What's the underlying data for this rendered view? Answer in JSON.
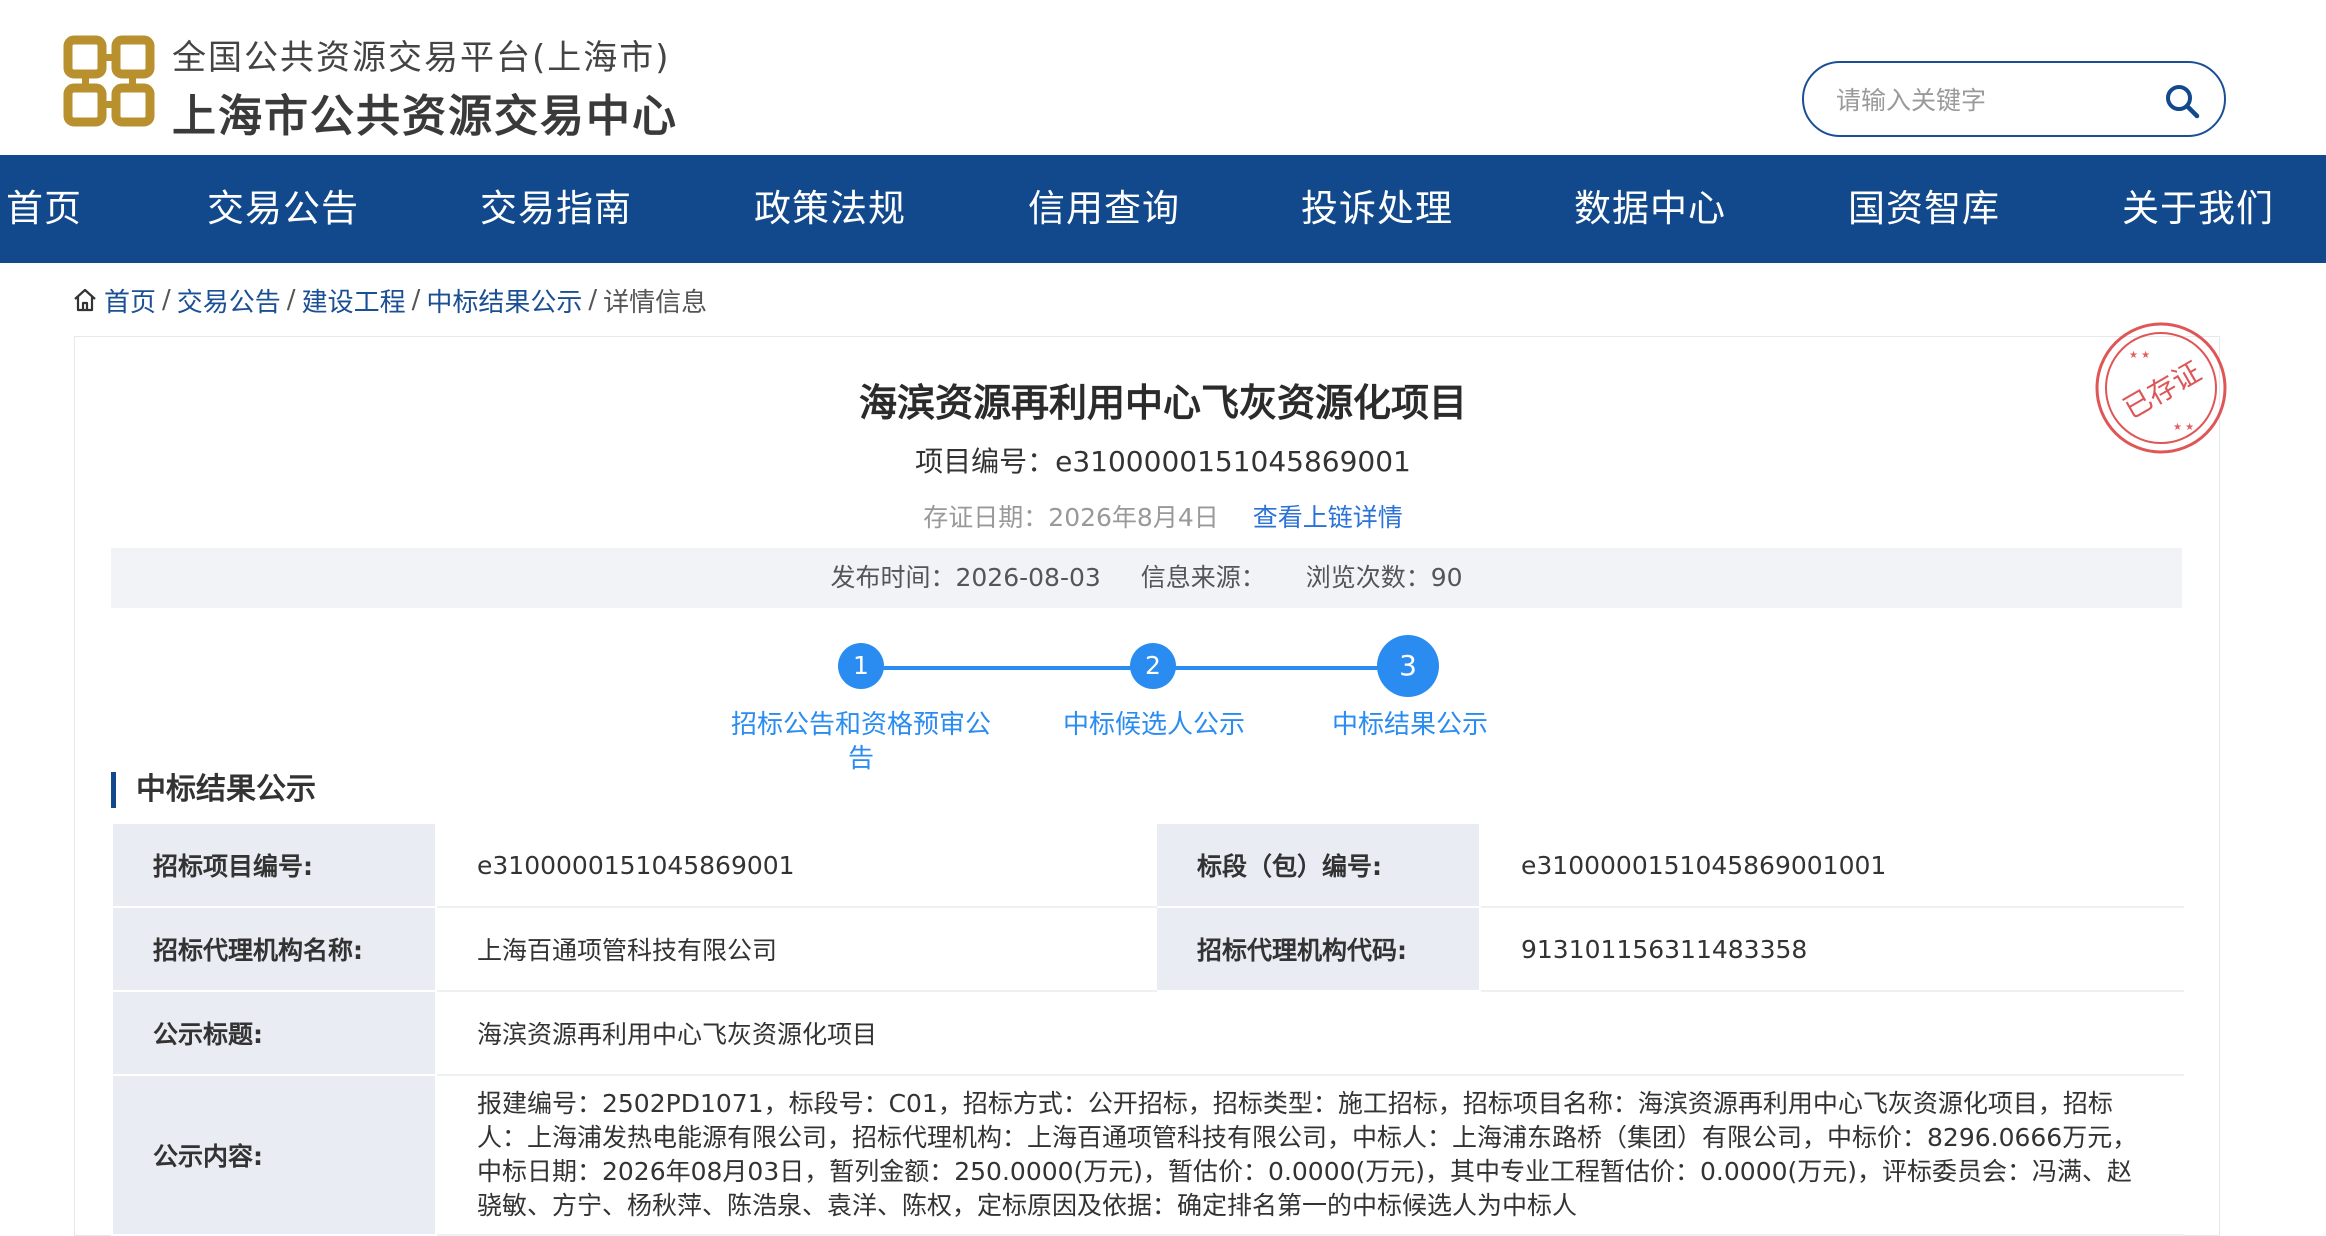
{
  "header": {
    "subtitle": "全国公共资源交易平台(上海市)",
    "title": "上海市公共资源交易中心",
    "search_placeholder": "请输入关键字"
  },
  "nav": {
    "items": [
      "首页",
      "交易公告",
      "交易指南",
      "政策法规",
      "信用查询",
      "投诉处理",
      "数据中心",
      "国资智库",
      "关于我们"
    ]
  },
  "breadcrumb": {
    "home": "首页",
    "items": [
      "交易公告",
      "建设工程",
      "中标结果公示"
    ],
    "current": "详情信息"
  },
  "stamp": {
    "text": "已存证"
  },
  "detail": {
    "title": "海滨资源再利用中心飞灰资源化项目",
    "project_no": "项目编号：e3100000151045869001",
    "cert_date": "存证日期：2026年8月4日",
    "cert_link": "查看上链详情",
    "publish_time": "发布时间：2026-08-03",
    "source": "信息来源：",
    "views": "浏览次数：90"
  },
  "steps": [
    {
      "num": "1",
      "label": "招标公告和资格预审公告"
    },
    {
      "num": "2",
      "label": "中标候选人公示"
    },
    {
      "num": "3",
      "label": "中标结果公示"
    }
  ],
  "section": {
    "title": "中标结果公示",
    "rows": {
      "project_no_label": "招标项目编号:",
      "project_no_value": "e3100000151045869001",
      "lot_no_label": "标段（包）编号:",
      "lot_no_value": "e3100000151045869001001",
      "agency_name_label": "招标代理机构名称:",
      "agency_name_value": "上海百通项管科技有限公司",
      "agency_code_label": "招标代理机构代码:",
      "agency_code_value": "913101156311483358",
      "notice_title_label": "公示标题:",
      "notice_title_value": "海滨资源再利用中心飞灰资源化项目",
      "content_label": "公示内容:",
      "content_value": "报建编号：2502PD1071，标段号：C01，招标方式：公开招标，招标类型：施工招标，招标项目名称：海滨资源再利用中心飞灰资源化项目，招标人：上海浦发热电能源有限公司，招标代理机构：上海百通项管科技有限公司，中标人：上海浦东路桥（集团）有限公司，中标价：8296.0666万元，中标日期：2026年08月03日，暂列金额：250.0000(万元)，暂估价：0.0000(万元)，其中专业工程暂估价：0.0000(万元)，评标委员会：冯满、赵骁敏、方宁、杨秋萍、陈浩泉、袁洋、陈权，定标原因及依据：确定排名第一的中标候选人为中标人"
    }
  },
  "colors": {
    "nav_bg": "#12498c",
    "accent_blue": "#2a8cf0",
    "logo_gold": "#b8912e",
    "stamp_red": "#d9383a"
  }
}
